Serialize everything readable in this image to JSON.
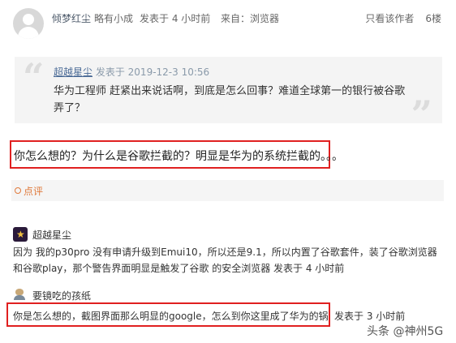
{
  "post": {
    "username": "倾梦红尘",
    "level": "略有小成",
    "time": "发表于 4 小时前",
    "source": "来自：浏览器",
    "only_author": "只看该作者",
    "floor": "6楼"
  },
  "quote": {
    "user": "超越星尘",
    "time": "发表于 2019-12-3 10:56",
    "text": "华为工程师 赶紧出来说话啊，到底是怎么回事？难道全球第一的银行被谷歌弄了？"
  },
  "main_text": "你怎么想的？为什么是谷歌拦截的？明显是华为的系统拦截的。。。",
  "comment_label": "点评",
  "comments": [
    {
      "user": "超越星尘",
      "text": "因为 我的p30pro 没有申请升级到Emui10，所以还是9.1，所以内置了谷歌套件，装了谷歌浏览器和谷歌play，那个警告界面明显是触发了谷歌 的安全浏览器  发表于 4 小时前"
    },
    {
      "user": "要镜吃的孩纸",
      "text": "你是怎么想的，截图界面那么明显的google，怎么到你这里成了华为的锅",
      "time": "发表于 3 小时前"
    }
  ],
  "watermark": "头条 @神州5G"
}
